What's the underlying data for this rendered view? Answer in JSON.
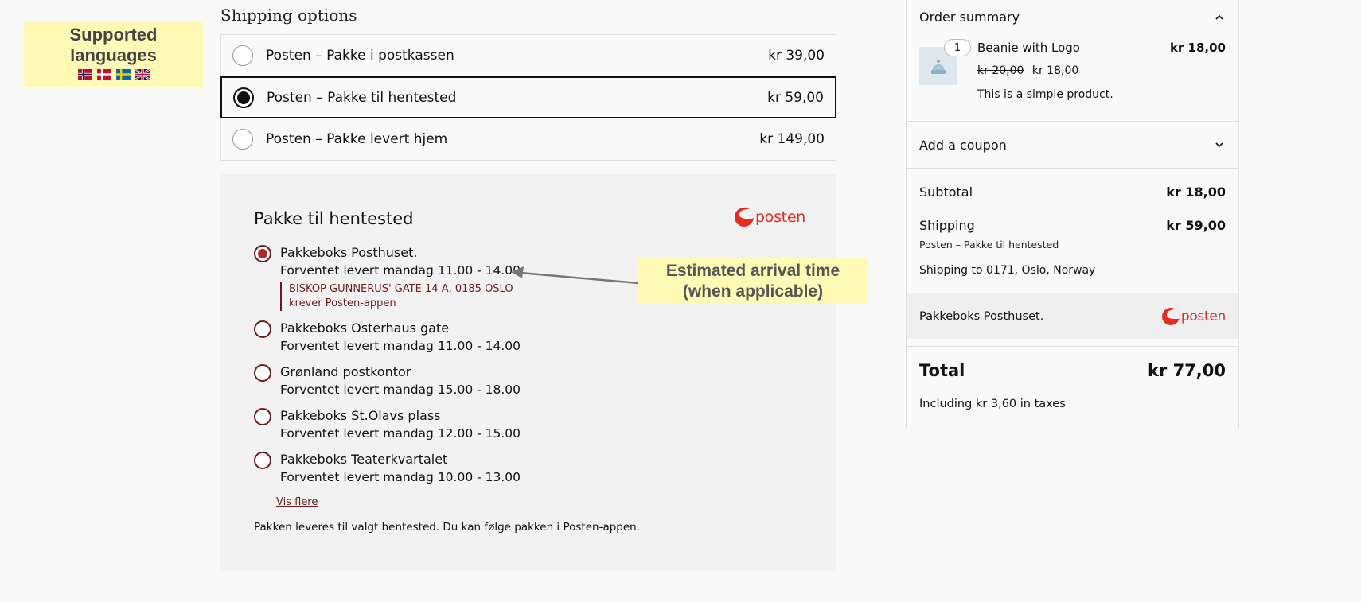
{
  "badge": {
    "title_line1": "Supported",
    "title_line2": "languages",
    "flags": [
      "norway-flag",
      "denmark-flag",
      "sweden-flag",
      "uk-flag"
    ]
  },
  "shipping": {
    "heading": "Shipping options",
    "options": [
      {
        "label": "Posten – Pakke i postkassen",
        "price": "kr 39,00",
        "selected": false
      },
      {
        "label": "Posten – Pakke til hentested",
        "price": "kr 59,00",
        "selected": true
      },
      {
        "label": "Posten – Pakke levert hjem",
        "price": "kr 149,00",
        "selected": false
      }
    ]
  },
  "pickup": {
    "title": "Pakke til hentested",
    "logo_text": "posten",
    "points": [
      {
        "name": "Pakkeboks Posthuset.",
        "eta": "Forventet levert mandag 11.00 - 14.00",
        "address": "BISKOP GUNNERUS' GATE 14 A, 0185 OSLO",
        "note": "krever Posten-appen",
        "selected": true
      },
      {
        "name": "Pakkeboks Osterhaus gate",
        "eta": "Forventet levert mandag 11.00 - 14.00",
        "selected": false
      },
      {
        "name": "Grønland postkontor",
        "eta": "Forventet levert mandag 15.00 - 18.00",
        "selected": false
      },
      {
        "name": "Pakkeboks St.Olavs plass",
        "eta": "Forventet levert mandag 12.00 - 15.00",
        "selected": false
      },
      {
        "name": "Pakkeboks Teaterkvartalet",
        "eta": "Forventet levert mandag 10.00 - 13.00",
        "selected": false
      }
    ],
    "more_link": "Vis flere",
    "footer_note": "Pakken leveres til valgt hentested. Du kan følge pakken i Posten-appen."
  },
  "callout": {
    "line1": "Estimated arrival time",
    "line2": "(when applicable)"
  },
  "summary": {
    "title": "Order summary",
    "product": {
      "qty": "1",
      "name": "Beanie with Logo",
      "line_total": "kr 18,00",
      "old_price": "kr 20,00",
      "price": "kr 18,00",
      "description": "This is a simple product."
    },
    "coupon_label": "Add a coupon",
    "subtotal_label": "Subtotal",
    "subtotal_value": "kr 18,00",
    "shipping_label": "Shipping",
    "shipping_value": "kr 59,00",
    "shipping_method": "Posten – Pakke til hentested",
    "shipping_to": "Shipping to 0171, Oslo, Norway",
    "pickup_selected": "Pakkeboks Posthuset.",
    "logo_text": "posten",
    "total_label": "Total",
    "total_value": "kr 77,00",
    "tax_note": "Including kr 3,60 in taxes"
  },
  "colors": {
    "accent": "#b0262b",
    "posten_red": "#e32d22",
    "badge_yellow": "#fffbb6"
  }
}
